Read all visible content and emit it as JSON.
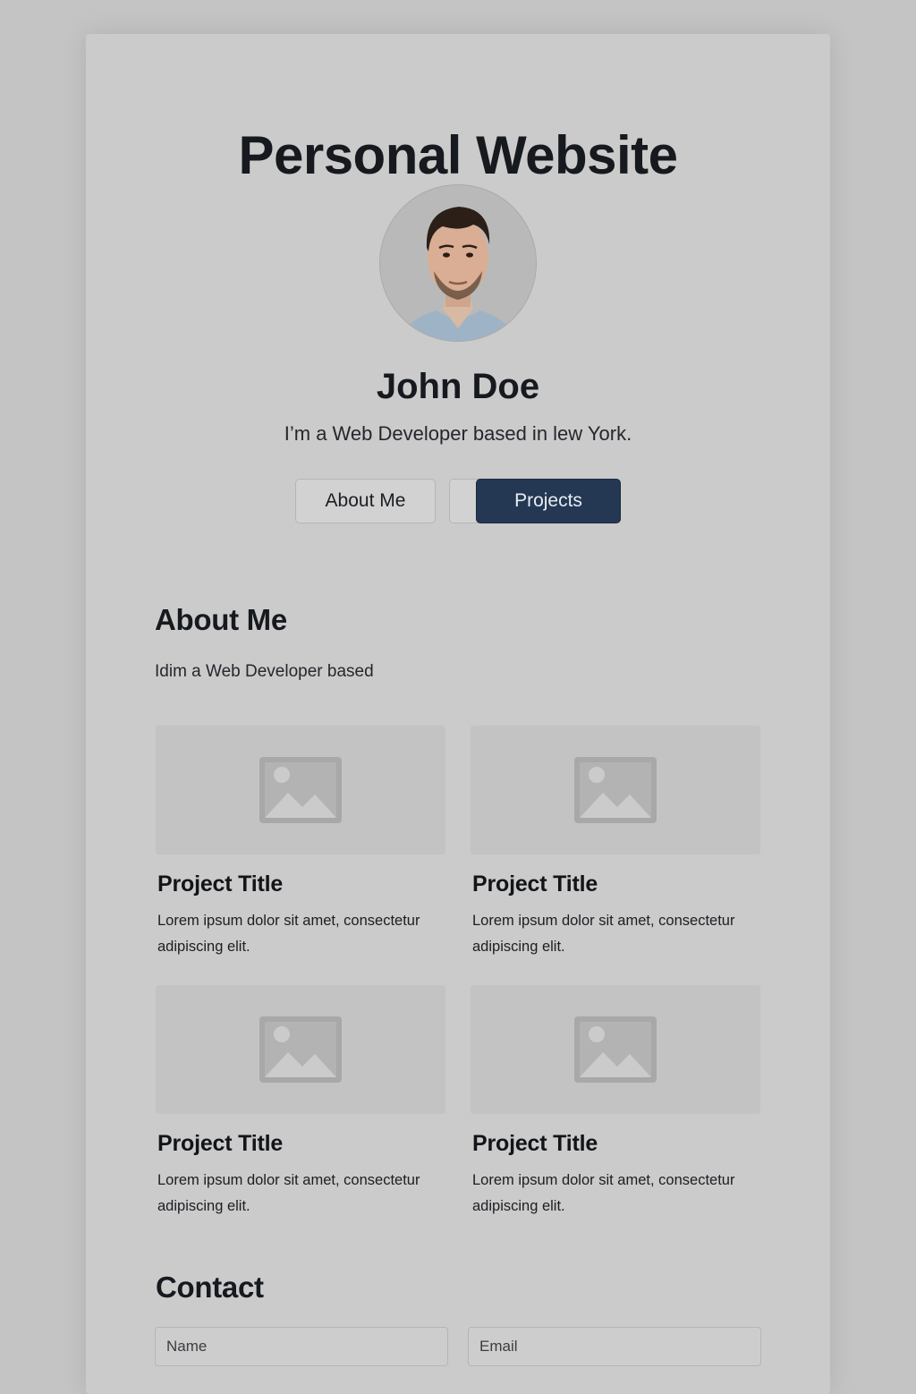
{
  "header": {
    "title": "Personal Website"
  },
  "profile": {
    "name": "John Doe",
    "tagline": "I’m a Web Developer based in lew York.",
    "avatar_icon": "portrait-photo"
  },
  "nav": {
    "about_label": "About Me",
    "projects_label": "Projects"
  },
  "about": {
    "heading": "About Me",
    "text": "Idim a Web Developer based"
  },
  "projects": [
    {
      "title": "Project Title",
      "description": "Lorem ipsum dolor sit amet, consectetur adipiscing elit.",
      "icon": "image-placeholder-icon"
    },
    {
      "title": "Project Title",
      "description": "Lorem ipsum dolor sit amet, consectetur adipiscing elit.",
      "icon": "image-placeholder-icon"
    },
    {
      "title": "Project Title",
      "description": "Lorem ipsum dolor sit amet, consectetur adipiscing elit.",
      "icon": "image-placeholder-icon"
    },
    {
      "title": "Project Title",
      "description": "Lorem ipsum dolor sit amet, consectetur adipiscing elit.",
      "icon": "image-placeholder-icon"
    }
  ],
  "contact": {
    "heading": "Contact",
    "name_placeholder": "Name",
    "email_placeholder": "Email"
  },
  "colors": {
    "page_background": "#c4c4c4",
    "card_background": "#cbcbcb",
    "primary_button": "#253853",
    "text": "#16191e"
  }
}
